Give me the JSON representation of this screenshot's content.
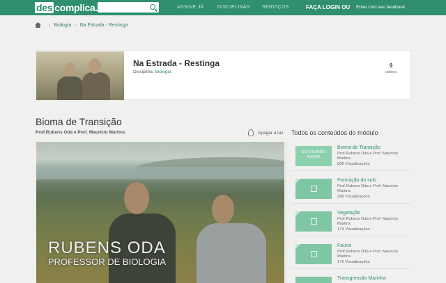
{
  "header": {
    "logo_left": "des",
    "logo_right": "complica.",
    "nav": [
      "ASSINE JÁ",
      "DISCIPLINAS",
      "SERVIÇOS"
    ],
    "login": "FAÇA LOGIN OU",
    "facebook": "Entre com seu facebook"
  },
  "breadcrumb": [
    "Biologia",
    "Na Estrada - Restinga"
  ],
  "course": {
    "title": "Na Estrada - Restinga",
    "discipline_label": "Disciplina:",
    "discipline": "Biologia",
    "video_count": "9",
    "video_count_label": "vídeos"
  },
  "lesson": {
    "title": "Bioma de Transição",
    "professors": "Prof.Rubens Oda e Prof. Maurício Martins",
    "lights_off": "Apagar a luz",
    "overlay_name": "RUBENS ODA",
    "overlay_role": "PROFESSOR DE BIOLOGIA"
  },
  "sidebar": {
    "title": "Todos os conteúdos do módulo",
    "now_label_1": "ESTUDANDO",
    "now_label_2": "AGORA",
    "items": [
      {
        "name": "Bioma de Transição",
        "prof": "Prof.Rubens Oda e Prof. Mauricio Martins",
        "views": "806 Visualizações"
      },
      {
        "name": "Formação do solo",
        "prof": "Prof.Rubens Oda e Prof. Mauricio Martins",
        "views": "286 Visualizações"
      },
      {
        "name": "Vegetação",
        "prof": "Prof.Rubens Oda e Prof. Mauricio Martins",
        "views": "174 Visualizações"
      },
      {
        "name": "Fauna",
        "prof": "Prof.Rubens Oda e Prof. Mauricio Martins",
        "views": "179 Visualizações"
      },
      {
        "name": "Transgressão Marinha",
        "prof": "",
        "views": ""
      }
    ]
  },
  "colors": {
    "brand": "#2f8f6f",
    "thumb": "#7fc6a4"
  }
}
